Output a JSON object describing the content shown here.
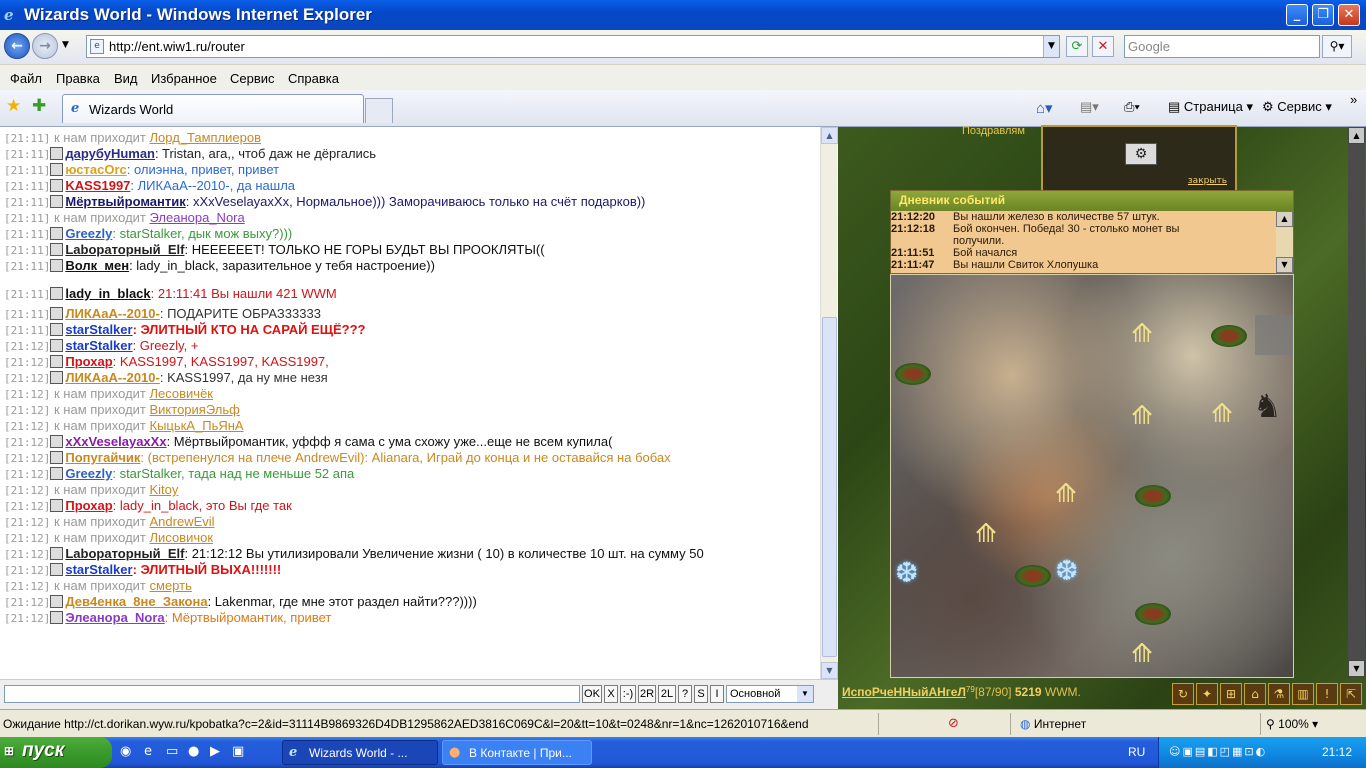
{
  "window": {
    "title": "Wizards World - Windows Internet Explorer"
  },
  "address": {
    "url": "http://ent.wiw1.ru/router",
    "search_placeholder": "Google"
  },
  "menu": [
    "Файл",
    "Правка",
    "Вид",
    "Избранное",
    "Сервис",
    "Справка"
  ],
  "tab": {
    "title": "Wizards World"
  },
  "toolbar": {
    "page": "Страница",
    "service": "Сервис"
  },
  "chat": {
    "lines": [
      {
        "time": "[21:11]",
        "parts": [
          {
            "t": "к нам приходит ",
            "c": "#9a9a9a"
          },
          {
            "t": "Лорд_Тамплиеров",
            "c": "#c8891f",
            "u": true
          }
        ]
      },
      {
        "time": "[21:11]",
        "parts": [
          {
            "t": "дарубу",
            "c": "#2b2b8a",
            "nick": true
          },
          {
            "t": "Human",
            "c": "#2b2b8a",
            "nick": true
          },
          {
            "t": ": Tristan, ага,, чтоб даж не дёргались",
            "c": "#222"
          }
        ]
      },
      {
        "time": "[21:11]",
        "parts": [
          {
            "t": "юстасOrc",
            "c": "#d9a21a",
            "nick": true
          },
          {
            "t": ": олиэнна, привет, привет",
            "c": "#2a6ad6"
          }
        ]
      },
      {
        "time": "[21:11]",
        "parts": [
          {
            "t": "KASS1997",
            "c": "#d0141a",
            "nick": true
          },
          {
            "t": ": ЛИКАаА--2010-, да нашла",
            "c": "#2a6ad6"
          }
        ]
      },
      {
        "time": "[21:11]",
        "parts": [
          {
            "t": "Мёртвыйромантик",
            "c": "#1a1a6a",
            "nick": true
          },
          {
            "t": ": xXxVeselayaxXx, Нормальное))) Заморачиваюсь только на счёт подарков))",
            "c": "#1a1a6a"
          }
        ]
      },
      {
        "time": "[21:11]",
        "parts": [
          {
            "t": "к нам приходит ",
            "c": "#9a9a9a"
          },
          {
            "t": "Элеанора_Nora",
            "c": "#8a3ac8",
            "u": true
          }
        ]
      },
      {
        "time": "[21:11]",
        "parts": [
          {
            "t": "Greezly",
            "c": "#2a5fc8",
            "nick": true
          },
          {
            "t": ": starStalker, дык мож выху?)))",
            "c": "#3a9a3a"
          }
        ]
      },
      {
        "time": "[21:11]",
        "parts": [
          {
            "t": "Lab",
            "c": "#222",
            "nick": true
          },
          {
            "t": "ораторный_Elf",
            "c": "#222",
            "nick": true
          },
          {
            "t": ": НЕЕЕЕЕЕТ! ТОЛЬКО НЕ ГОРЫ БУДЬТ ВЫ ПРООКЛЯТЫ((",
            "c": "#111"
          }
        ]
      },
      {
        "time": "[21:11]",
        "parts": [
          {
            "t": "Волк_мен",
            "c": "#111",
            "nick": true
          },
          {
            "t": ": lady_in_black, заразительное у тебя настроение))",
            "c": "#111"
          }
        ]
      },
      {
        "time": "[21:11]",
        "parts": [
          {
            "t": "lady_in_black",
            "c": "#111",
            "nick": true
          },
          {
            "t": ": 21:11:41 Вы нашли 421 WWM",
            "c": "#d0141a"
          }
        ]
      },
      {
        "time": "[21:11]",
        "parts": [
          {
            "t": "ЛИКАаА--2010-",
            "c": "#c8891f",
            "nick": true
          },
          {
            "t": ": ПОДАРИТЕ ОБРАЗ33333",
            "c": "#333"
          }
        ]
      },
      {
        "time": "[21:11]",
        "parts": [
          {
            "t": "starStalker",
            "c": "#1a3ac8",
            "nick": true
          },
          {
            "t": ": ЭЛИТНЫЙ КТО НА САРАЙ ЕЩЁ???",
            "c": "#e01010",
            "b": true
          }
        ]
      },
      {
        "time": "[21:12]",
        "parts": [
          {
            "t": "starStalker",
            "c": "#1a3ac8",
            "nick": true
          },
          {
            "t": ": Greezly, +",
            "c": "#d0141a"
          }
        ]
      },
      {
        "time": "[21:12]",
        "parts": [
          {
            "t": "Прохар",
            "c": "#d0141a",
            "nick": true
          },
          {
            "t": ": KASS1997, KASS1997, KASS1997,",
            "c": "#d0141a"
          }
        ]
      },
      {
        "time": "[21:12]",
        "parts": [
          {
            "t": "ЛИКАаА--2010-",
            "c": "#c8891f",
            "nick": true
          },
          {
            "t": ": KASS1997, да ну мне незя",
            "c": "#333"
          }
        ]
      },
      {
        "time": "[21:12]",
        "parts": [
          {
            "t": "к нам приходит ",
            "c": "#9a9a9a"
          },
          {
            "t": "Лесовичёк",
            "c": "#c8891f",
            "u": true
          }
        ]
      },
      {
        "time": "[21:12]",
        "parts": [
          {
            "t": "к нам приходит ",
            "c": "#9a9a9a"
          },
          {
            "t": "ВикторияЭльф",
            "c": "#c8891f",
            "u": true
          }
        ]
      },
      {
        "time": "[21:12]",
        "parts": [
          {
            "t": "к нам приходит ",
            "c": "#9a9a9a"
          },
          {
            "t": "КыцькА_ПьЯнА",
            "c": "#c8891f",
            "u": true
          }
        ]
      },
      {
        "time": "[21:12]",
        "parts": [
          {
            "t": "xXxVeselayaxXx",
            "c": "#8a1aa8",
            "nick": true
          },
          {
            "t": ": Мёртвыйромантик, уффф",
            "c": "#111"
          },
          {
            "t": " я сама с ума схожу уже...еще не всем купила(",
            "c": "#111"
          }
        ]
      },
      {
        "time": "[21:12]",
        "parts": [
          {
            "t": "Попугайчик",
            "c": "#c8891f",
            "nick": true
          },
          {
            "t": ": (встрепенулся на плече AndrewEvil): Alianara, Играй до конца и не оставайся на бобах",
            "c": "#c8891f"
          }
        ]
      },
      {
        "time": "[21:12]",
        "parts": [
          {
            "t": "Greezly",
            "c": "#2a5fc8",
            "nick": true
          },
          {
            "t": ": starStalker, тада над не меньше 52 апа",
            "c": "#3a9a3a"
          }
        ]
      },
      {
        "time": "[21:12]",
        "parts": [
          {
            "t": "к нам приходит ",
            "c": "#9a9a9a"
          },
          {
            "t": "Kitoy",
            "c": "#c8891f",
            "u": true
          }
        ]
      },
      {
        "time": "[21:12]",
        "parts": [
          {
            "t": "Прохар",
            "c": "#d0141a",
            "nick": true
          },
          {
            "t": ": lady_in_black, это Вы где так",
            "c": "#d0141a"
          }
        ]
      },
      {
        "time": "[21:12]",
        "parts": [
          {
            "t": "к нам приходит ",
            "c": "#9a9a9a"
          },
          {
            "t": "AndrewEvil",
            "c": "#c8891f",
            "u": true
          }
        ]
      },
      {
        "time": "[21:12]",
        "parts": [
          {
            "t": "к нам приходит ",
            "c": "#9a9a9a"
          },
          {
            "t": "Лисовичок",
            "c": "#c8891f",
            "u": true
          }
        ]
      },
      {
        "time": "[21:12]",
        "parts": [
          {
            "t": "Lab",
            "c": "#222",
            "nick": true
          },
          {
            "t": "ораторный_Elf",
            "c": "#222",
            "nick": true
          },
          {
            "t": ": 21:12:12 Вы утилизировали Увеличение жизни ( 10) в количестве 10 шт. на сумму 50",
            "c": "#111"
          }
        ]
      },
      {
        "time": "[21:12]",
        "parts": [
          {
            "t": "starStalker",
            "c": "#1a3ac8",
            "nick": true
          },
          {
            "t": ": ЭЛИТНЫЙ ВЫХА!!!!!!!",
            "c": "#e01010",
            "b": true
          }
        ]
      },
      {
        "time": "[21:12]",
        "parts": [
          {
            "t": "к нам приходит ",
            "c": "#9a9a9a"
          },
          {
            "t": "смерть",
            "c": "#c8891f",
            "u": true
          }
        ]
      },
      {
        "time": "[21:12]",
        "parts": [
          {
            "t": "Дев4енка_8не_Закона",
            "c": "#c8891f",
            "nick": true
          },
          {
            "t": ": Lakenmar, где мне этот раздел найти???))))",
            "c": "#111"
          }
        ]
      },
      {
        "time": "[21:12]",
        "parts": [
          {
            "t": "Элеанора_Nora",
            "c": "#8a3ac8",
            "nick": true
          },
          {
            "t": ": Мёртвыйромантик, привет",
            "c": "#d87a1a"
          }
        ]
      }
    ],
    "buttons": [
      "OK",
      "X",
      ":-)",
      "2R",
      "2L",
      "?",
      "S",
      "I"
    ],
    "channel": "Основной"
  },
  "game": {
    "greeting": "Поздравлям",
    "popup_close": "закрыть",
    "diary_title": "Дневник событий",
    "diary": [
      {
        "time": "21:12:20",
        "text": "Вы нашли железо в количестве 57 штук."
      },
      {
        "time": "21:12:18",
        "text": "Бой окончен. Победа! 30 - столько монет вы"
      },
      {
        "time": "",
        "text": "получили."
      },
      {
        "time": "21:11:51",
        "text": "Бой начался"
      },
      {
        "time": "21:11:47",
        "text": "Вы нашли Свиток Хлопушка"
      }
    ],
    "player": {
      "name": "ИспоРчеННыйАНгеЛ",
      "level": "79",
      "hp": "[87/90]",
      "money": "5219",
      "currency": "WWM."
    }
  },
  "statusbar": {
    "message": "Ожидание http://ct.dorikan.wyw.ru/kpobatka?c=2&id=31114B9869326D4DB1295862AED3816C069C&l=20&tt=10&t=0248&nr=1&nc=1262010716&end",
    "zone": "Интернет",
    "zoom": "100%"
  },
  "taskbar": {
    "start": "пуск",
    "tasks": [
      "Wizards World - ...",
      "В Контакте | При..."
    ],
    "lang": "RU",
    "clock": "21:12"
  },
  "colors": {
    "title_blue": "#0548c9",
    "taskbar_blue": "#245edb",
    "start_green": "#3a9a2c"
  }
}
